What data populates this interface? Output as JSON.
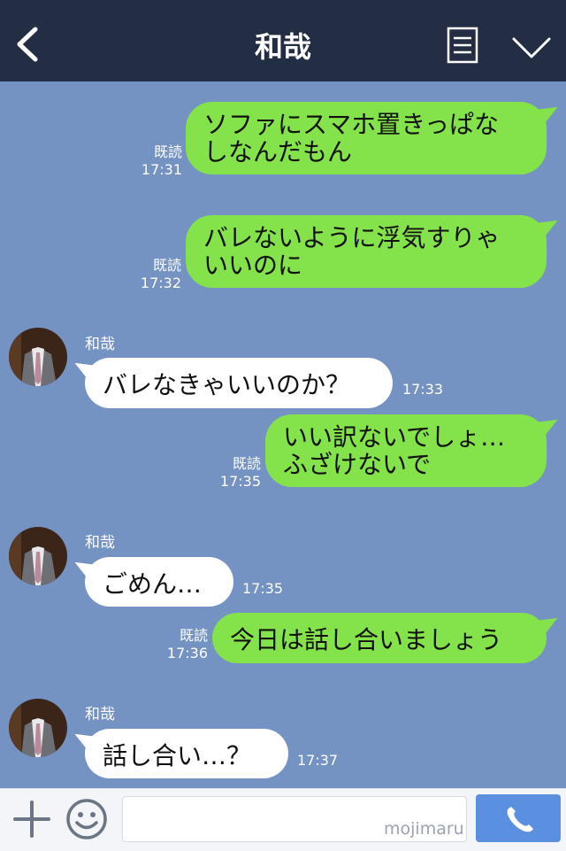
{
  "header": {
    "title": "和哉",
    "icons": {
      "back": "chevron-left-icon",
      "menu": "menu-list-icon",
      "collapse": "chevron-down-icon"
    }
  },
  "messages": [
    {
      "from": "me",
      "line1": "ソファにスマホ置きっぱな",
      "line2": "しなんだもん",
      "read": "既読",
      "time": "17:31"
    },
    {
      "from": "me",
      "line1": "バレないように浮気すりゃ",
      "line2": "いいのに",
      "read": "既読",
      "time": "17:32"
    },
    {
      "from": "them",
      "name": "和哉",
      "text": "バレなきゃいいのか？",
      "time": "17:33"
    },
    {
      "from": "me",
      "line1": "いい訳ないでしょ…",
      "line2": "ふざけないで",
      "read": "既読",
      "time": "17:35"
    },
    {
      "from": "them",
      "name": "和哉",
      "text": "ごめん…",
      "time": "17:35"
    },
    {
      "from": "me",
      "text": "今日は話し合いましょう",
      "read": "既読",
      "time": "17:36"
    },
    {
      "from": "them",
      "name": "和哉",
      "text": "話し合い…？",
      "time": "17:37"
    }
  ],
  "input": {
    "placeholder": "",
    "watermark": "mojimaru",
    "icons": {
      "add": "plus-icon",
      "emoji": "smiley-icon",
      "call": "phone-icon"
    }
  },
  "colors": {
    "header": "#232d44",
    "background": "#7493c2",
    "my_bubble": "#84e24a",
    "their_bubble": "#ffffff",
    "call_button": "#5b8fe0"
  }
}
